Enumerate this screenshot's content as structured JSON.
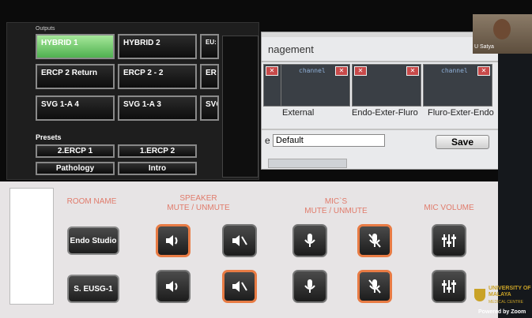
{
  "routing": {
    "header": "Outputs",
    "buttons": [
      "HYBRID 1",
      "HYBRID 2",
      "EU: MO",
      "ERCP 2 Return",
      "ERCP 2 - 2",
      "ER",
      "SVG 1-A 4",
      "SVG 1-A 3",
      "SVC"
    ],
    "presets_title": "Presets",
    "presets": [
      "2.ERCP 1",
      "1.ERCP 2",
      "Pathology",
      "Intro"
    ]
  },
  "management": {
    "title": "nagement",
    "channel_label": "channel",
    "outputs": [
      "External",
      "Endo-Exter-Fluro",
      "Fluro-Exter-Endo"
    ],
    "preset_value": "Default",
    "preset_prefix": "e",
    "save_label": "Save"
  },
  "touch_panel": {
    "headers": {
      "room": "ROOM NAME",
      "speaker": "SPEAKER\nMUTE / UNMUTE",
      "mics": "MIC`S\nMUTE / UNMUTE",
      "volume": "MIC VOLUME"
    },
    "rooms": [
      "Endo Studio",
      "S. EUSG-1"
    ]
  },
  "zoom": {
    "participant_name": "U Satya",
    "powered_by": "Powered by Zoom"
  },
  "branding": {
    "university": "UNIVERSITY OF MALAYA",
    "medical_centre": "MEDICAL CENTRE"
  },
  "colors": {
    "accent_orange": "#e87b44",
    "header_red": "#e07b6b",
    "active_green": "#7fd07a"
  }
}
